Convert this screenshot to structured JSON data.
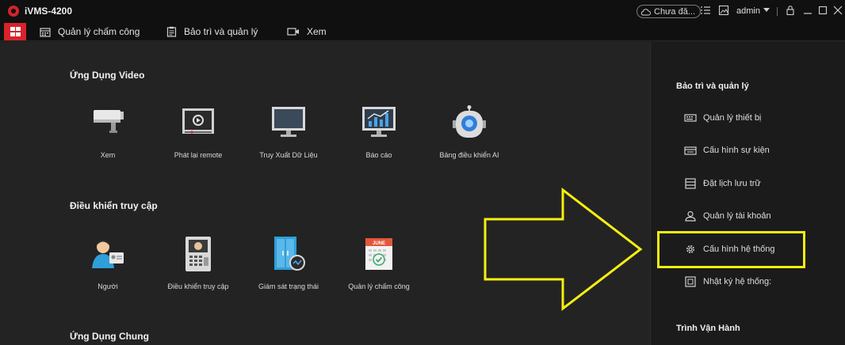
{
  "window": {
    "title": "iVMS-4200",
    "cloud_status": "Chưa đă...",
    "user": "admin"
  },
  "menu": {
    "items": [
      {
        "label": "Quản lý chấm công",
        "icon": "calendar-icon"
      },
      {
        "label": "Bảo trì và quản lý",
        "icon": "clipboard-icon"
      },
      {
        "label": "Xem",
        "icon": "camera-icon"
      }
    ]
  },
  "sections": {
    "video": {
      "title": "Ứng Dụng Video",
      "apps": [
        {
          "label": "Xem",
          "icon": "cctv-camera-icon"
        },
        {
          "label": "Phát lại remote",
          "icon": "playback-icon"
        },
        {
          "label": "Truy Xuất Dữ Liệu",
          "icon": "monitor-icon"
        },
        {
          "label": "Báo cáo",
          "icon": "report-chart-icon"
        },
        {
          "label": "Bảng điều khiển AI",
          "icon": "ai-robot-icon"
        }
      ]
    },
    "access": {
      "title": "Điều khiển truy cập",
      "apps": [
        {
          "label": "Người",
          "icon": "person-card-icon"
        },
        {
          "label": "Điều khiển truy cập",
          "icon": "intercom-icon"
        },
        {
          "label": "Giám sát trạng thái",
          "icon": "door-monitor-icon"
        },
        {
          "label": "Quản lý chấm công",
          "icon": "attendance-calendar-icon"
        }
      ]
    },
    "common": {
      "title": "Ứng Dụng Chung"
    }
  },
  "calendar_badge": "JUNE",
  "right_panel": {
    "title": "Bảo trì và quản lý",
    "items": [
      {
        "label": "Quản lý thiết bị",
        "icon": "device-icon"
      },
      {
        "label": "Cấu hình sự kiện",
        "icon": "event-icon"
      },
      {
        "label": "Đặt lịch lưu trữ",
        "icon": "storage-icon"
      },
      {
        "label": "Quản lý tài khoản",
        "icon": "user-icon"
      },
      {
        "label": "Cấu hình hệ thống",
        "icon": "gear-icon"
      },
      {
        "label": "Nhật ký hệ thống:",
        "icon": "log-icon"
      }
    ],
    "footer_title": "Trình Vận Hành"
  },
  "colors": {
    "accent_red": "#d8232a",
    "highlight_yellow": "#f5ef11"
  }
}
